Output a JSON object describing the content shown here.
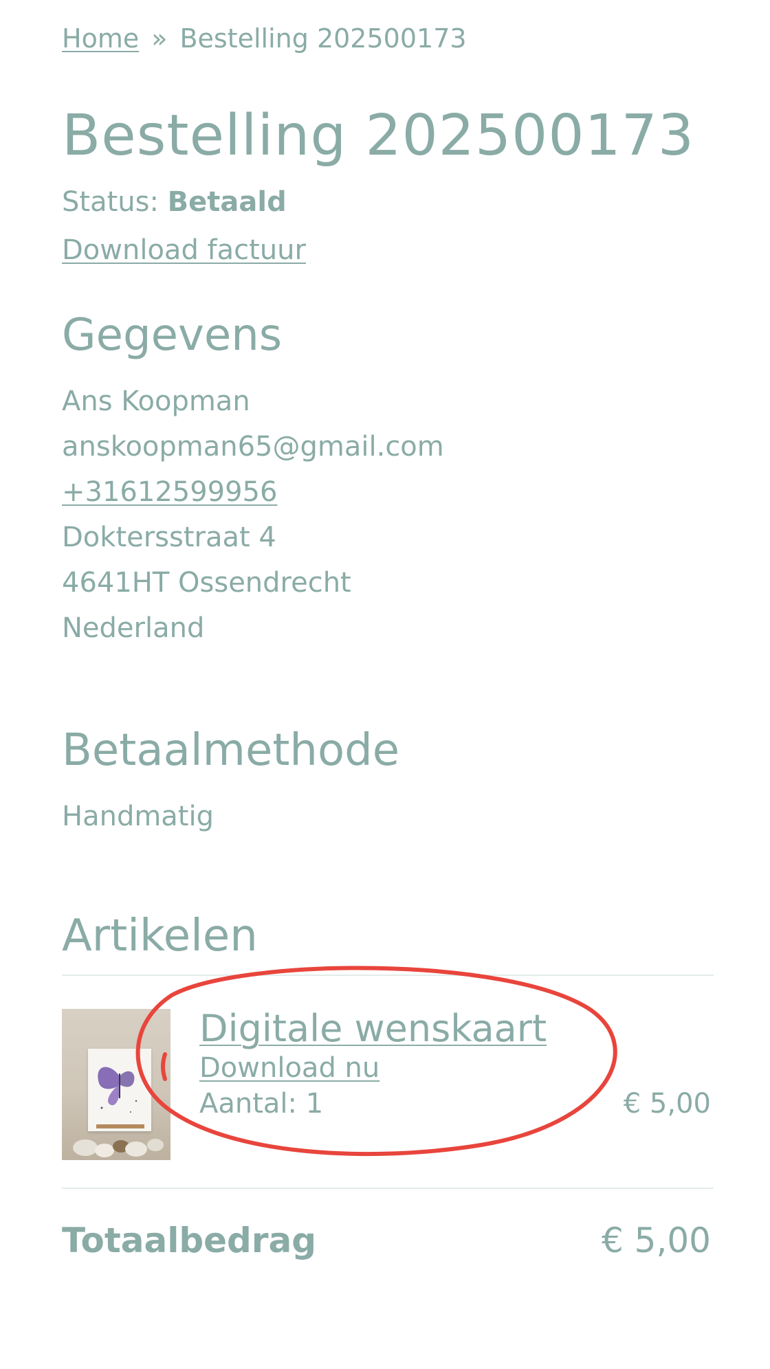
{
  "breadcrumb": {
    "home": "Home",
    "separator": "»",
    "current": "Bestelling 202500173"
  },
  "order": {
    "title": "Bestelling 202500173",
    "status_label": "Status:",
    "status_value": "Betaald",
    "invoice_link": "Download factuur"
  },
  "details": {
    "heading": "Gegevens",
    "name": "Ans Koopman",
    "email": "anskoopman65@gmail.com",
    "phone": "+31612599956",
    "street": "Doktersstraat 4",
    "postal_city": "4641HT Ossendrecht",
    "country": "Nederland"
  },
  "payment": {
    "heading": "Betaalmethode",
    "method": "Handmatig"
  },
  "items": {
    "heading": "Artikelen",
    "list": [
      {
        "title": "Digitale wenskaart",
        "download": "Download nu",
        "quantity": "Aantal: 1",
        "price": "€ 5,00",
        "image_icon": "butterfly-card-image"
      }
    ]
  },
  "total": {
    "label": "Totaalbedrag",
    "value": "€ 5,00"
  },
  "colors": {
    "text": "#8aaba6",
    "divider": "#e3ecea",
    "annotation": "#e8453c",
    "background": "#ffffff"
  }
}
